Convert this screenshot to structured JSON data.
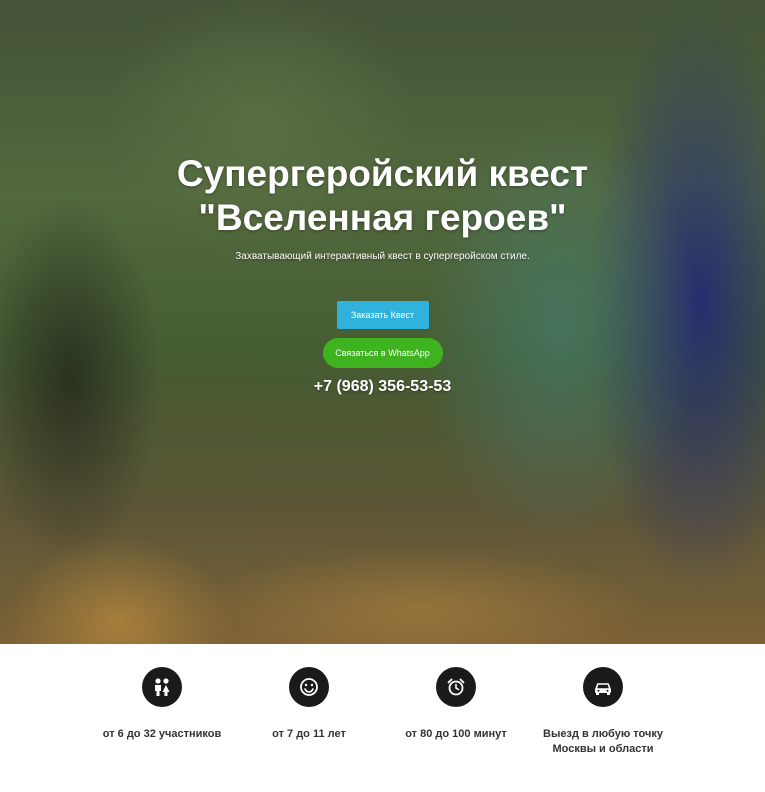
{
  "hero": {
    "title_line1": "Супергеройский квест",
    "title_line2": "\"Вселенная героев\"",
    "subtitle": "Захватывающий интерактивный квест в супергеройском стиле.",
    "order_button": "Заказать Квест",
    "whatsapp_button": "Связаться в WhatsApp",
    "phone": "+7 (968) 356-53-53",
    "colors": {
      "order": "#2fb3dd",
      "whatsapp": "#3eb21f"
    }
  },
  "features": [
    {
      "icon": "children-icon",
      "label": "от 6 до 32 участников"
    },
    {
      "icon": "smiley-icon",
      "label": "от 7 до 11 лет"
    },
    {
      "icon": "alarm-clock-icon",
      "label": "от 80 до 100 минут"
    },
    {
      "icon": "car-icon",
      "label_line1": "Выезд в любую точку",
      "label_line2": "Москвы и области"
    }
  ]
}
